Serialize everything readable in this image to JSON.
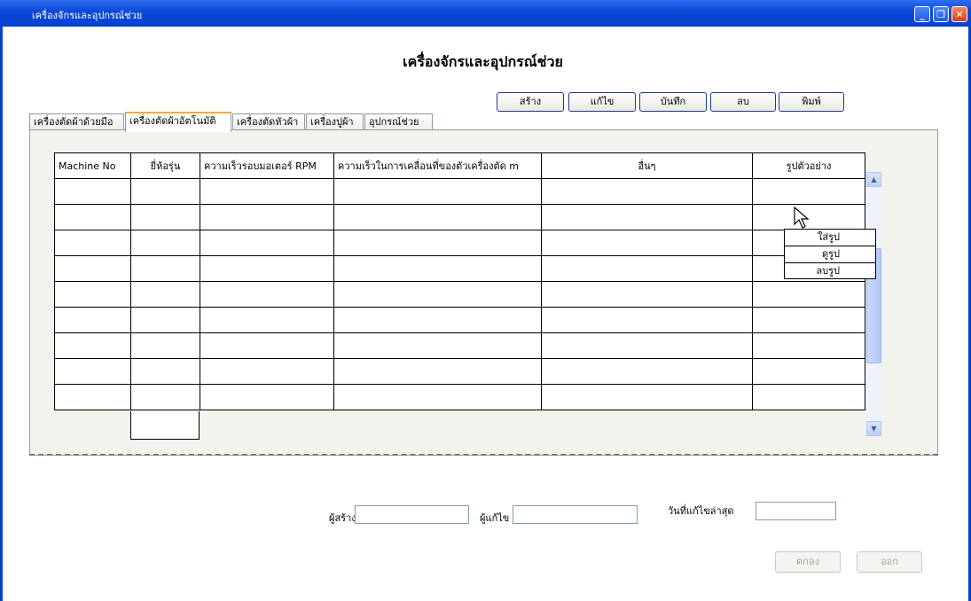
{
  "window": {
    "title": "เครื่องจักรและอุปกรณ์ช่วย"
  },
  "heading": "เครื่องจักรและอุปกรณ์ช่วย",
  "toolbar": {
    "create": "สร้าง",
    "edit": "แก้ไข",
    "save": "บันทึก",
    "delete": "ลบ",
    "print": "พิมพ์"
  },
  "tabs": [
    "เครื่องตัดผ้าด้วยมือ",
    "เครื่องตัดผ้าอัตโนมัติ",
    "เครื่องตัดหัวผ้า",
    "เครื่องปูผ้า",
    "อุปกรณ์ช่วย"
  ],
  "table": {
    "headers": [
      "Machine No",
      "ยี่ห้อรุ่น",
      "ความเร็วรอบมอเตอร์ RPM",
      "ความเร็วในการเคลื่อนที่ของตัวเครื่องตัด m",
      "อื่นๆ",
      "รูปตัวอย่าง"
    ]
  },
  "context_menu": [
    "ใส่รูป",
    "ดูรูป",
    "ลบรูป"
  ],
  "form": {
    "creator_label": "ผู้สร้าง",
    "editor_label": "ผู้แก้ไข",
    "date_label": "วันที่แก้ไขล่าสุด"
  },
  "footer": {
    "ok": "ตกลง",
    "exit": "ออก"
  }
}
